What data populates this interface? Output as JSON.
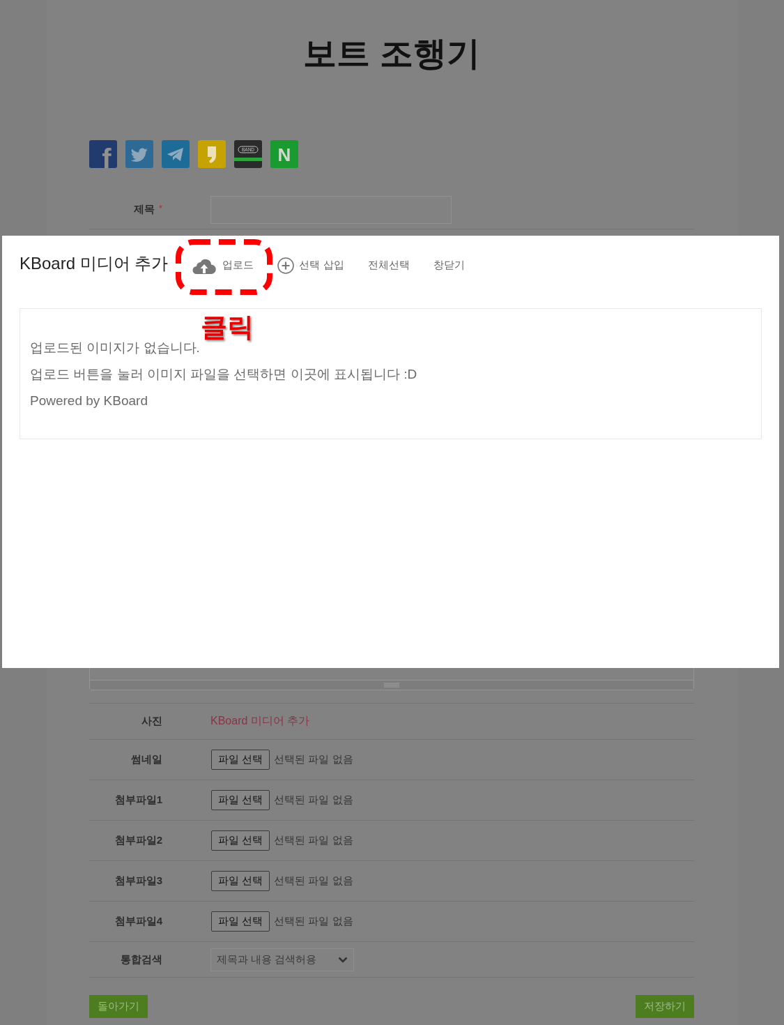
{
  "page": {
    "title": "보트 조행기"
  },
  "share_buttons": [
    {
      "kind": "facebook",
      "mark": "f"
    },
    {
      "kind": "twitter"
    },
    {
      "kind": "telegram"
    },
    {
      "kind": "kakaostory"
    },
    {
      "kind": "band",
      "mark": "BAND"
    },
    {
      "kind": "naver",
      "mark": "N"
    }
  ],
  "form": {
    "title_field": {
      "label": "제목",
      "required_mark": "*"
    },
    "rows": [
      {
        "kind": "media",
        "label": "사진",
        "link": "KBoard 미디어 추가"
      },
      {
        "kind": "file",
        "label": "썸네일",
        "button": "파일 선택",
        "status": "선택된 파일 없음"
      },
      {
        "kind": "file",
        "label": "첨부파일1",
        "button": "파일 선택",
        "status": "선택된 파일 없음"
      },
      {
        "kind": "file",
        "label": "첨부파일2",
        "button": "파일 선택",
        "status": "선택된 파일 없음"
      },
      {
        "kind": "file",
        "label": "첨부파일3",
        "button": "파일 선택",
        "status": "선택된 파일 없음"
      },
      {
        "kind": "file",
        "label": "첨부파일4",
        "button": "파일 선택",
        "status": "선택된 파일 없음"
      },
      {
        "kind": "select",
        "label": "통합검색",
        "value": "제목과 내용 검색허용"
      }
    ]
  },
  "buttons": [
    {
      "kind": "back",
      "label": "돌아가기"
    },
    {
      "kind": "save",
      "label": "저장하기"
    }
  ],
  "media_modal": {
    "title": "KBoard 미디어 추가",
    "actions": [
      {
        "kind": "upload",
        "label": "업로드",
        "highlighted": true
      },
      {
        "kind": "insert",
        "label": "선택 삽입",
        "highlighted": false
      },
      {
        "kind": "select_all",
        "label": "전체선택",
        "highlighted": false
      },
      {
        "kind": "close",
        "label": "창닫기",
        "highlighted": false
      }
    ],
    "messages": [
      "업로드된 이미지가 없습니다.",
      "업로드 버튼을 눌러 이미지 파일을 선택하면 이곳에 표시됩니다 :D",
      "Powered by KBoard"
    ]
  },
  "annotation": {
    "label": "클릭"
  }
}
